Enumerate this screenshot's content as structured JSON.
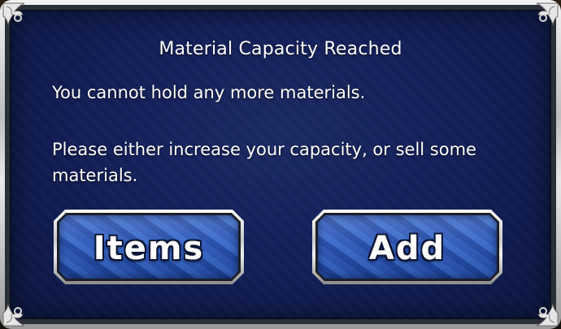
{
  "dialog": {
    "title": "Material Capacity Reached",
    "message_line_1": "You cannot hold any more materials.",
    "message_line_2": "Please either increase your capacity, or sell some materials."
  },
  "buttons": {
    "items_label": "Items",
    "add_label": "Add"
  },
  "colors": {
    "panel": "#13205a",
    "button_face": "#2550b0",
    "frame": "#c8c8c8",
    "text": "#ffffff"
  },
  "icons": {
    "corner": "ornate-scroll-corner-icon"
  }
}
